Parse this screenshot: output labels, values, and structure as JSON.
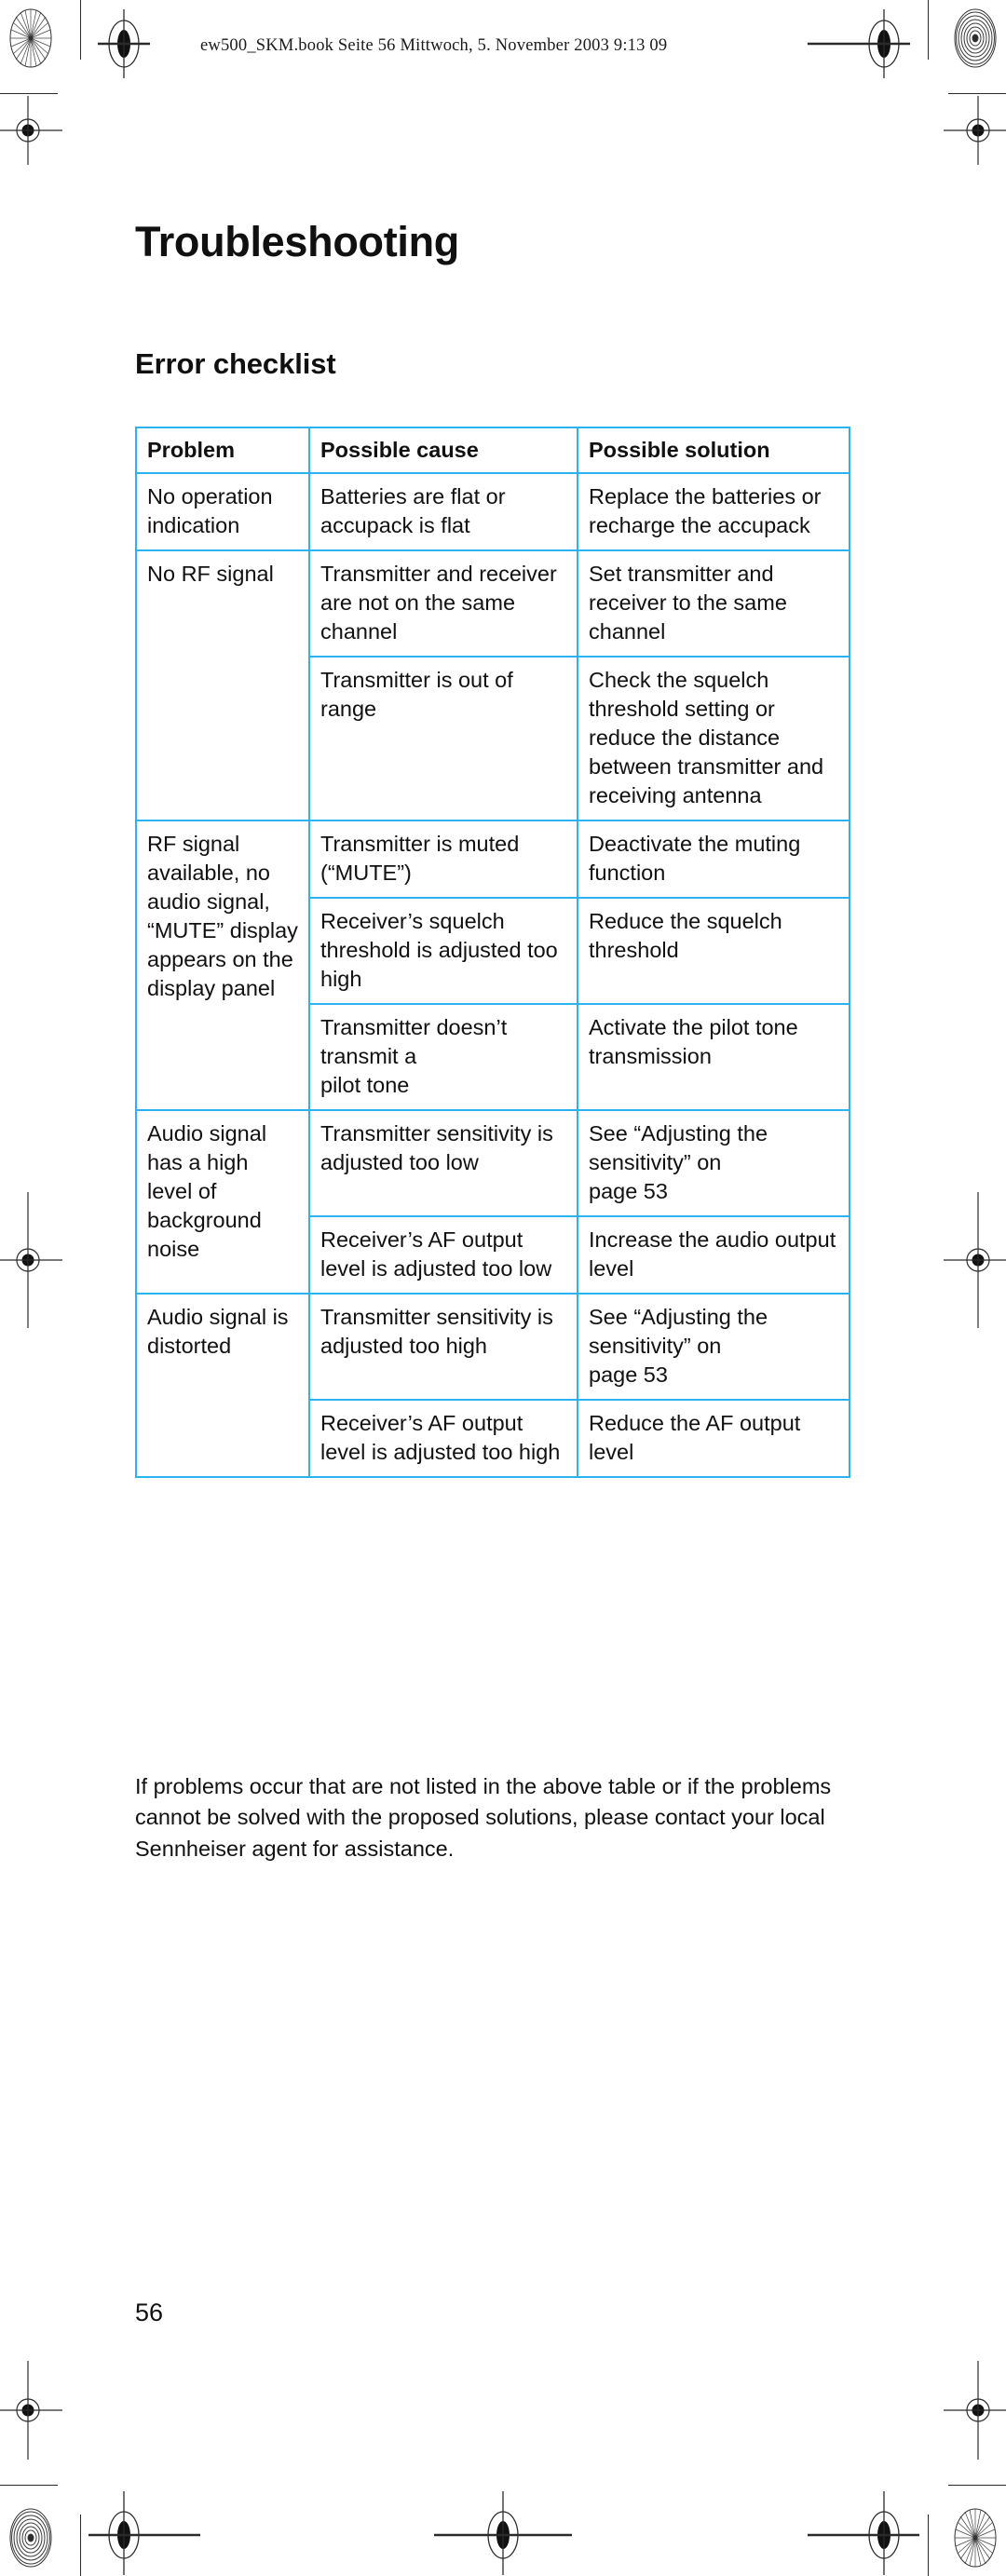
{
  "running_head": {
    "text": "ew500_SKM.book  Seite 56  Mittwoch, 5. November 2003  9:13 09"
  },
  "page": {
    "title": "Troubleshooting",
    "section_title": "Error checklist",
    "folio": "56"
  },
  "table": {
    "headers": [
      "Problem",
      "Possible cause",
      "Possible solution"
    ],
    "rows": [
      {
        "problem": "No operation indication",
        "problem_rowspan": 1,
        "entries": [
          {
            "cause": "Batteries are flat or accupack is flat",
            "solution": "Replace the batteries or recharge the accupack"
          }
        ]
      },
      {
        "problem": "No RF signal",
        "problem_rowspan": 2,
        "entries": [
          {
            "cause": "Transmitter and receiver are not on the same channel",
            "solution": "Set transmitter and receiver to the same channel"
          },
          {
            "cause": "Transmitter is out of range",
            "solution": "Check the squelch threshold setting or reduce the distance between transmitter and receiving antenna"
          }
        ]
      },
      {
        "problem": "RF signal available, no audio signal, “MUTE” display appears on the display panel",
        "problem_rowspan": 3,
        "entries": [
          {
            "cause": "Transmitter is muted (“MUTE”)",
            "solution": "Deactivate the muting function"
          },
          {
            "cause": "Receiver’s squelch threshold is adjusted too high",
            "solution": "Reduce the squelch threshold"
          },
          {
            "cause": "Transmitter doesn’t transmit a\npilot tone",
            "solution": "Activate the pilot tone transmission"
          }
        ]
      },
      {
        "problem": "Audio signal has a high level of background noise",
        "problem_rowspan": 2,
        "entries": [
          {
            "cause": "Transmitter sensitivity is adjusted too low",
            "solution": "See “Adjusting the sensitivity” on\npage 53"
          },
          {
            "cause": "Receiver’s AF output level is adjusted too low",
            "solution": "Increase the audio output level"
          }
        ]
      },
      {
        "problem": "Audio signal is distorted",
        "problem_rowspan": 2,
        "entries": [
          {
            "cause": "Transmitter sensitivity is adjusted too high",
            "solution": "See “Adjusting the sensitivity” on\npage 53"
          },
          {
            "cause": "Receiver’s AF output level is adjusted too high",
            "solution": "Reduce the AF output level"
          }
        ]
      }
    ]
  },
  "closing_paragraph": "If problems occur that are not listed in the above table or if the problems cannot be solved with the proposed solutions, please contact your local Sennheiser agent for assistance.",
  "colors": {
    "table_border": "#2bb3ef",
    "text": "#111111",
    "marks": "#2b2b2b"
  }
}
